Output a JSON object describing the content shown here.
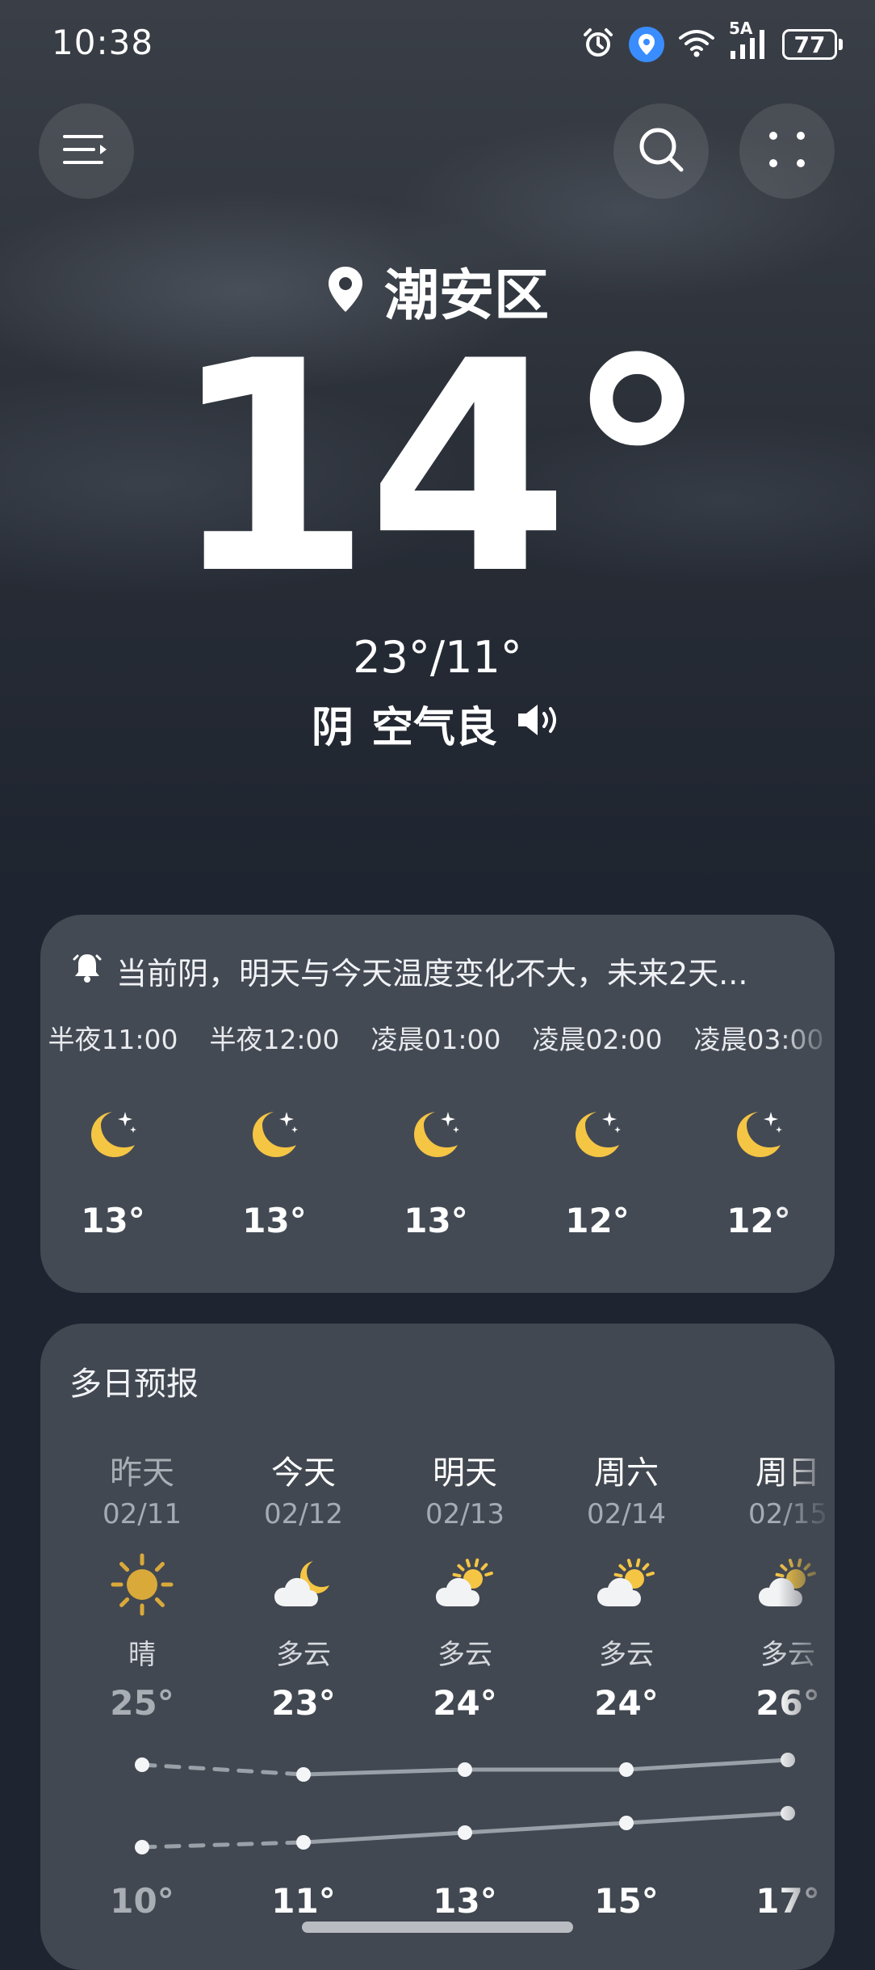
{
  "status_bar": {
    "time": "10:38",
    "network": "5A",
    "battery": "77"
  },
  "header": {
    "menu_icon": "menu-icon",
    "search_icon": "search-icon",
    "more_icon": "grid-dots-icon"
  },
  "location": {
    "name": "潮安区",
    "icon": "location-pin-icon"
  },
  "current": {
    "temperature": "14°",
    "high_low": "23°/11°",
    "condition": "阴",
    "air_quality": "空气良",
    "speaker_icon": "speaker-icon"
  },
  "hourly": {
    "alert": "当前阴，明天与今天温度变化不大，未来2天...",
    "items": [
      {
        "time": "半夜11:00",
        "temp": "13°",
        "icon": "moon-stars-icon"
      },
      {
        "time": "半夜12:00",
        "temp": "13°",
        "icon": "moon-stars-icon"
      },
      {
        "time": "凌晨01:00",
        "temp": "13°",
        "icon": "moon-stars-icon"
      },
      {
        "time": "凌晨02:00",
        "temp": "12°",
        "icon": "moon-stars-icon"
      },
      {
        "time": "凌晨03:00",
        "temp": "12°",
        "icon": "moon-stars-icon"
      }
    ]
  },
  "daily": {
    "title": "多日预报",
    "items": [
      {
        "day": "昨天",
        "date": "02/11",
        "cond": "晴",
        "high": "25°",
        "low": "10°",
        "icon": "sun-icon",
        "high_value": 25,
        "low_value": 10
      },
      {
        "day": "今天",
        "date": "02/12",
        "cond": "多云",
        "high": "23°",
        "low": "11°",
        "icon": "moon-cloud-icon",
        "high_value": 23,
        "low_value": 11
      },
      {
        "day": "明天",
        "date": "02/13",
        "cond": "多云",
        "high": "24°",
        "low": "13°",
        "icon": "sun-cloud-icon",
        "high_value": 24,
        "low_value": 13
      },
      {
        "day": "周六",
        "date": "02/14",
        "cond": "多云",
        "high": "24°",
        "low": "15°",
        "icon": "sun-cloud-icon",
        "high_value": 24,
        "low_value": 15
      },
      {
        "day": "周日",
        "date": "02/15",
        "cond": "多云",
        "high": "26°",
        "low": "17°",
        "icon": "sun-cloud-icon",
        "high_value": 26,
        "low_value": 17
      }
    ]
  },
  "colors": {
    "sun": "#f5c544",
    "line": "#9aa0a8",
    "card": "#444a54"
  }
}
